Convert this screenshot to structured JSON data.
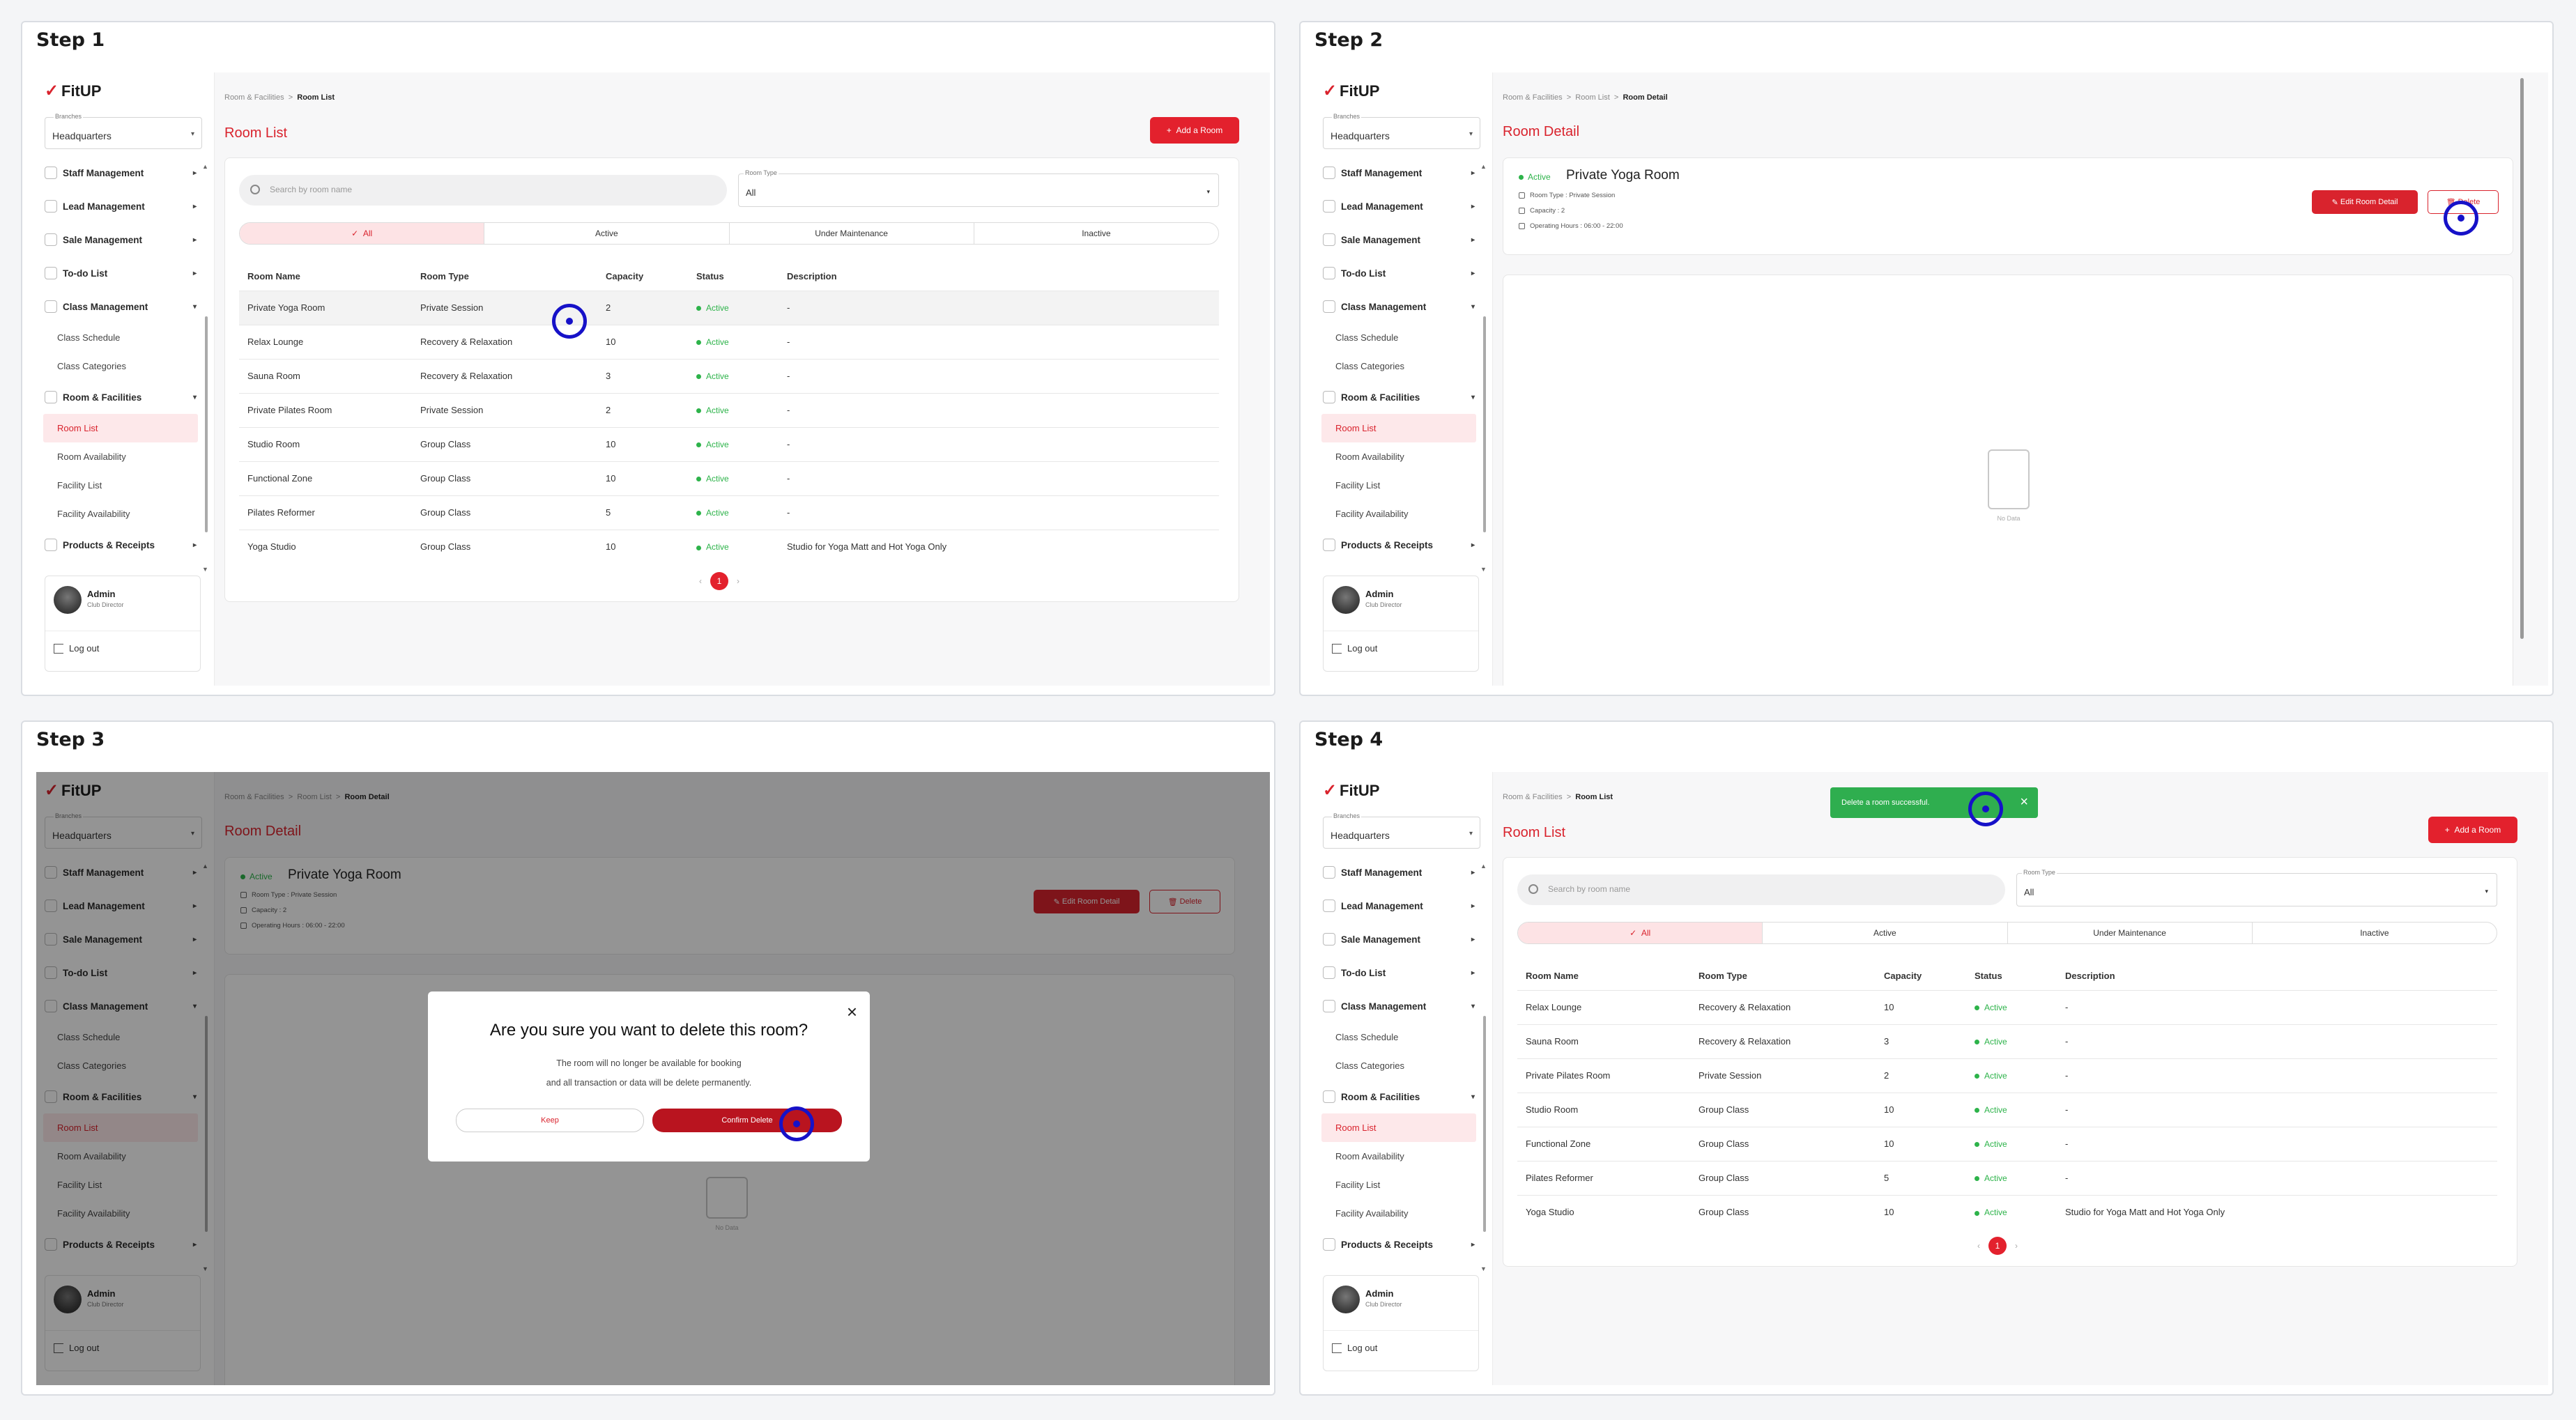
{
  "steps": [
    {
      "title": "Step 1"
    },
    {
      "title": "Step 2"
    },
    {
      "title": "Step 3"
    },
    {
      "title": "Step 4"
    }
  ],
  "app": {
    "logo": "FitUP",
    "branch_label": "Branches",
    "branch_value": "Headquarters",
    "nav": {
      "staff": "Staff Management",
      "lead": "Lead Management",
      "sale": "Sale Management",
      "todo": "To-do List",
      "class": "Class Management",
      "class_schedule": "Class Schedule",
      "class_categories": "Class Categories",
      "room": "Room & Facilities",
      "room_list": "Room List",
      "room_availability": "Room Availability",
      "facility_list": "Facility List",
      "facility_availability": "Facility Availability",
      "products": "Products & Receipts"
    },
    "user": {
      "name": "Admin",
      "role": "Club Director",
      "logout": "Log out"
    }
  },
  "list": {
    "crumb_parent": "Room & Facilities",
    "crumb_sep": ">",
    "crumb_current": "Room List",
    "title": "Room List",
    "add_button": "Add a Room",
    "add_icon": "+",
    "search_placeholder": "Search by room name",
    "room_type_label": "Room Type",
    "room_type_value": "All",
    "tabs": [
      "All",
      "Active",
      "Under Maintenance",
      "Inactive"
    ],
    "tab_check": "✓",
    "columns": [
      "Room Name",
      "Room Type",
      "Capacity",
      "Status",
      "Description"
    ],
    "rows": [
      [
        "Private Yoga Room",
        "Private Session",
        "2",
        "Active",
        "-"
      ],
      [
        "Relax Lounge",
        "Recovery & Relaxation",
        "10",
        "Active",
        "-"
      ],
      [
        "Sauna Room",
        "Recovery & Relaxation",
        "3",
        "Active",
        "-"
      ],
      [
        "Private Pilates Room",
        "Private Session",
        "2",
        "Active",
        "-"
      ],
      [
        "Studio Room",
        "Group Class",
        "10",
        "Active",
        "-"
      ],
      [
        "Functional Zone",
        "Group Class",
        "10",
        "Active",
        "-"
      ],
      [
        "Pilates Reformer",
        "Group Class",
        "5",
        "Active",
        "-"
      ],
      [
        "Yoga Studio",
        "Group Class",
        "10",
        "Active",
        "Studio for Yoga Matt and Hot Yoga Only"
      ]
    ],
    "rows_after": [
      [
        "Relax Lounge",
        "Recovery & Relaxation",
        "10",
        "Active",
        "-"
      ],
      [
        "Sauna Room",
        "Recovery & Relaxation",
        "3",
        "Active",
        "-"
      ],
      [
        "Private Pilates Room",
        "Private Session",
        "2",
        "Active",
        "-"
      ],
      [
        "Studio Room",
        "Group Class",
        "10",
        "Active",
        "-"
      ],
      [
        "Functional Zone",
        "Group Class",
        "10",
        "Active",
        "-"
      ],
      [
        "Pilates Reformer",
        "Group Class",
        "5",
        "Active",
        "-"
      ],
      [
        "Yoga Studio",
        "Group Class",
        "10",
        "Active",
        "Studio for Yoga Matt and Hot Yoga Only"
      ]
    ],
    "page": "1",
    "prev": "‹",
    "next": "›"
  },
  "detail": {
    "crumb_parent": "Room & Facilities",
    "crumb_mid": "Room List",
    "crumb_current": "Room Detail",
    "title": "Room Detail",
    "status": "Active",
    "room_name": "Private Yoga Room",
    "room_type": "Room Type : Private Session",
    "capacity": "Capacity : 2",
    "hours": "Operating Hours : 06:00 - 22:00",
    "edit_button": "Edit Room Detail",
    "delete_button": "Delete",
    "no_data": "No Data"
  },
  "modal": {
    "title": "Are you sure you want to delete this room?",
    "line1": "The room will no longer be available for booking",
    "line2": "and all transaction or data will be delete permanently.",
    "keep": "Keep",
    "confirm": "Confirm Delete",
    "close": "×"
  },
  "toast": {
    "text": "Delete a room successful.",
    "close": "×"
  },
  "colors": {
    "brand": "#d9232d",
    "active": "#2db34a",
    "cursor": "#1611c8",
    "toast": "#2fae4f"
  }
}
